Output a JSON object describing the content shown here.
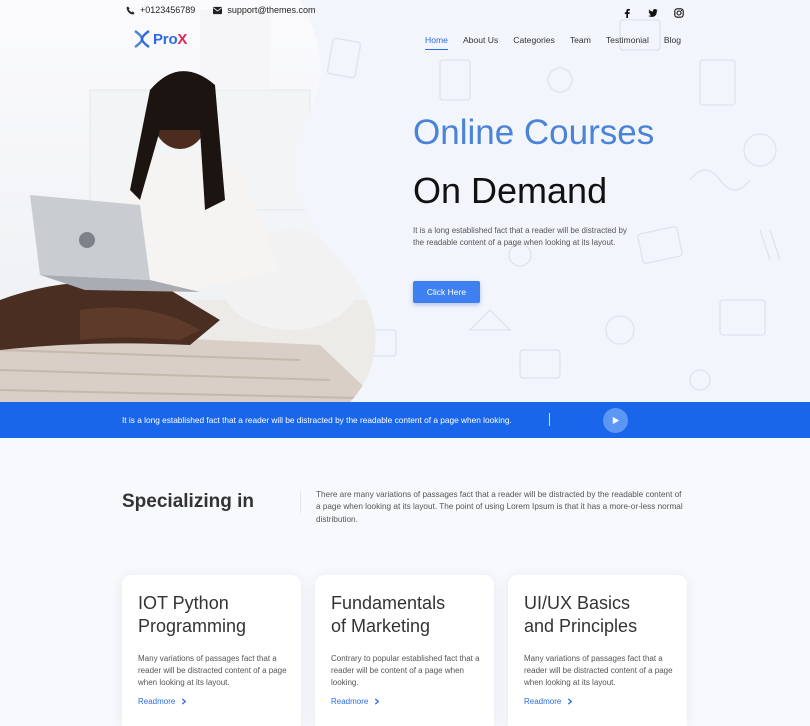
{
  "topbar": {
    "phone": "+0123456789",
    "email": "support@themes.com"
  },
  "brand": {
    "name_a": "Pro",
    "name_b": "X",
    "primary": "#2d6be4",
    "accent": "#e0245e"
  },
  "nav": [
    "Home",
    "About Us",
    "Categories",
    "Team",
    "Testimonial",
    "Blog"
  ],
  "hero": {
    "title_line1": "Online Courses",
    "title_line2": "On Demand",
    "text": "It is a long established fact that a reader will be distracted by the readable content of a page when looking at its layout.",
    "cta": "Click Here"
  },
  "banner": {
    "text": "It is a long established fact that a reader will be distracted by the readable content of a page when looking."
  },
  "specializing": {
    "title": "Specializing in",
    "text": "There are many variations of passages fact that a reader will be distracted by the readable content of a page when looking at its layout. The point of using Lorem Ipsum is that it has a more-or-less normal distribution."
  },
  "cards": [
    {
      "title_1": "IOT Python",
      "title_2": "Programming",
      "desc": "Many variations of passages fact that a reader will be distracted content of a page when looking at its layout.",
      "link": "Readmore"
    },
    {
      "title_1": "Fundamentals",
      "title_2": "of Marketing",
      "desc": "Contrary to popular established fact that a reader will be content of a page when looking.",
      "link": "Readmore"
    },
    {
      "title_1": "UI/UX Basics",
      "title_2": "and Principles",
      "desc": "Many variations of passages fact that a reader will be distracted content of a page when looking at its layout.",
      "link": "Readmore"
    }
  ],
  "icons": {
    "phone": "phone-icon",
    "email": "envelope-icon",
    "social": [
      "facebook-icon",
      "twitter-icon",
      "instagram-icon"
    ],
    "play": "play-icon",
    "readmore": "chevron-right-icon"
  }
}
